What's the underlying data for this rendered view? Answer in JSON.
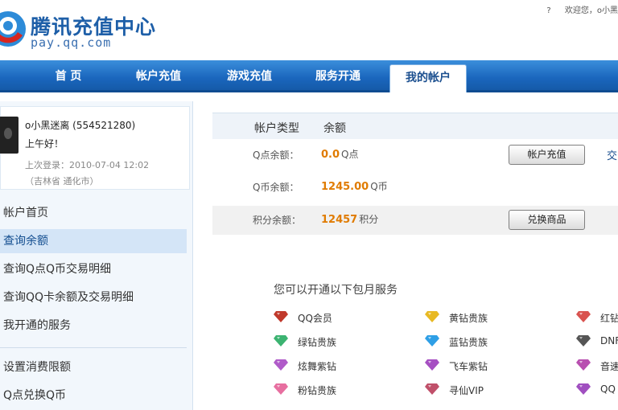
{
  "header": {
    "logo_title": "腾讯充值中心",
    "logo_sub": "pay.qq.com",
    "links": [
      "?",
      "欢迎您，o小黑"
    ]
  },
  "nav": {
    "items": [
      "首 页",
      "帐户充值",
      "游戏充值",
      "服务开通",
      "我的帐户"
    ],
    "active_index": 4
  },
  "user": {
    "name": "o小黑迷离 (554521280)",
    "greeting": "上午好！",
    "last_login": "上次登录：2010-07-04 12:02",
    "location": "（吉林省 通化市）"
  },
  "sidebar": {
    "items": [
      "帐户首页",
      "查询余额",
      "查询Q点Q币交易明细",
      "查询QQ卡余额及交易明细",
      "我开通的服务",
      "设置消费限额",
      "Q点兑换Q币"
    ],
    "active_index": 1
  },
  "main": {
    "header_col1": "帐户类型",
    "header_col2": "余额",
    "rows": [
      {
        "label": "Q点余额：",
        "value": "0.0",
        "unit": "Q点",
        "button": "帐户充值"
      },
      {
        "label": "Q币余额：",
        "value": "1245.00",
        "unit": "Q币",
        "button": ""
      },
      {
        "label": "积分余额：",
        "value": "12457",
        "unit": "积分",
        "button": "兑换商品"
      }
    ],
    "cut_link": "交"
  },
  "services": {
    "title": "您可以开通以下包月服务",
    "items": [
      {
        "name": "QQ会员",
        "icon": "qq-member-icon",
        "color": "#c0392b"
      },
      {
        "name": "黄钻贵族",
        "icon": "yellow-diamond-icon",
        "color": "#e8b923"
      },
      {
        "name": "红钻",
        "icon": "red-diamond-icon",
        "color": "#d9534f"
      },
      {
        "name": "绿钻贵族",
        "icon": "green-diamond-icon",
        "color": "#3cb371"
      },
      {
        "name": "蓝钻贵族",
        "icon": "blue-diamond-icon",
        "color": "#2e9fe6"
      },
      {
        "name": "DNF",
        "icon": "dnf-icon",
        "color": "#555555"
      },
      {
        "name": "炫舞紫钻",
        "icon": "purple-diamond-icon",
        "color": "#b05bc9"
      },
      {
        "name": "飞车紫钻",
        "icon": "speed-purple-diamond-icon",
        "color": "#a64fc2"
      },
      {
        "name": "音速",
        "icon": "music-diamond-icon",
        "color": "#b84fb0"
      },
      {
        "name": "粉钻贵族",
        "icon": "pink-diamond-icon",
        "color": "#e76fa0"
      },
      {
        "name": "寻仙VIP",
        "icon": "xunxian-vip-icon",
        "color": "#c0506a"
      },
      {
        "name": "QQ",
        "icon": "qq-game-icon",
        "color": "#a04fc0"
      }
    ]
  }
}
